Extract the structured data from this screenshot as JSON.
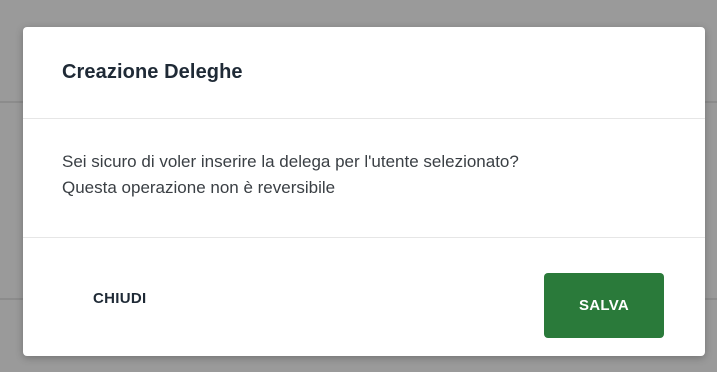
{
  "backdrop": {
    "color": "#9a9a9a"
  },
  "dialog": {
    "title": "Creazione Deleghe",
    "message_line1": "Sei sicuro di voler inserire la delega per l'utente selezionato?",
    "message_line2": "Questa operazione non è reversibile",
    "close_label": "CHIUDI",
    "save_label": "SALVA",
    "save_color": "#2a7a3a"
  }
}
